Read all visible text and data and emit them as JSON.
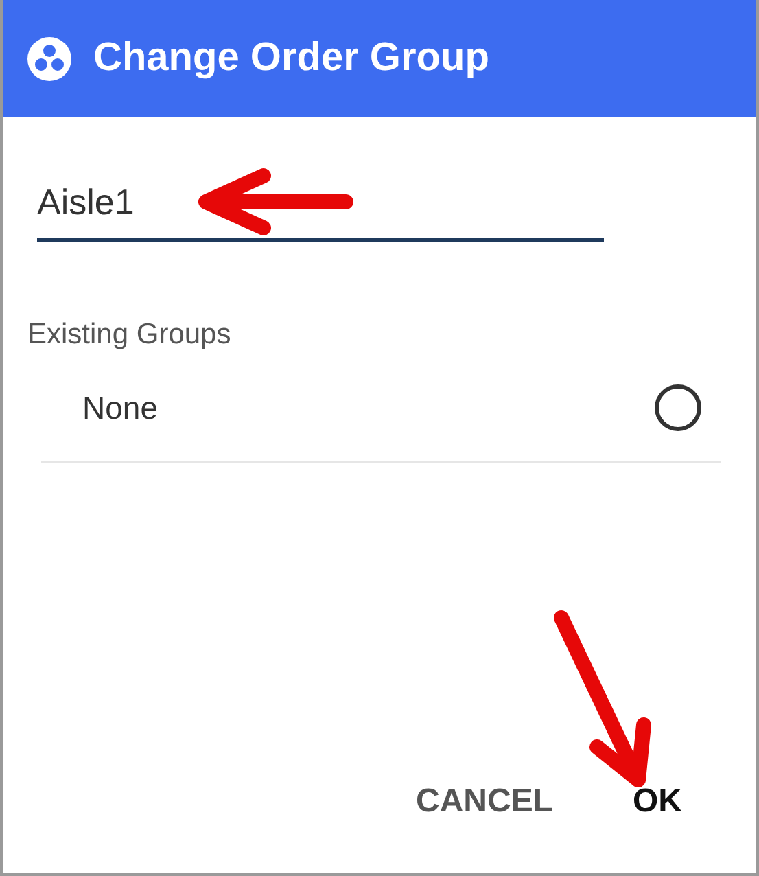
{
  "dialog": {
    "title": "Change Order Group"
  },
  "group_name_field": {
    "value": "Aisle1"
  },
  "existing_groups": {
    "label": "Existing Groups",
    "options": [
      {
        "label": "None",
        "selected": false
      }
    ]
  },
  "buttons": [
    {
      "label": "CANCEL",
      "kind": "dismiss"
    },
    {
      "label": "OK",
      "kind": "confirm"
    }
  ]
}
